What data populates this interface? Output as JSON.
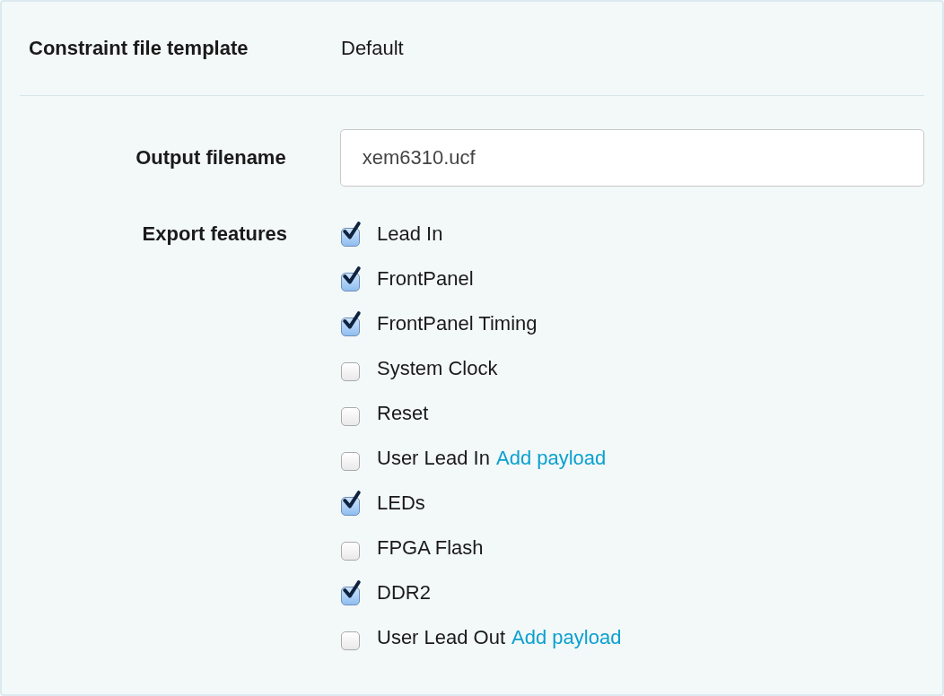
{
  "template": {
    "label": "Constraint file template",
    "value": "Default"
  },
  "output": {
    "label": "Output filename",
    "value": "xem6310.ucf"
  },
  "features": {
    "label": "Export features",
    "items": [
      {
        "label": "Lead In",
        "checked": true
      },
      {
        "label": "FrontPanel",
        "checked": true
      },
      {
        "label": "FrontPanel Timing",
        "checked": true
      },
      {
        "label": "System Clock",
        "checked": false
      },
      {
        "label": "Reset",
        "checked": false
      },
      {
        "label": "User Lead In",
        "checked": false,
        "link": "Add payload"
      },
      {
        "label": "LEDs",
        "checked": true
      },
      {
        "label": "FPGA Flash",
        "checked": false
      },
      {
        "label": "DDR2",
        "checked": true
      },
      {
        "label": "User Lead Out",
        "checked": false,
        "link": "Add payload"
      }
    ]
  }
}
